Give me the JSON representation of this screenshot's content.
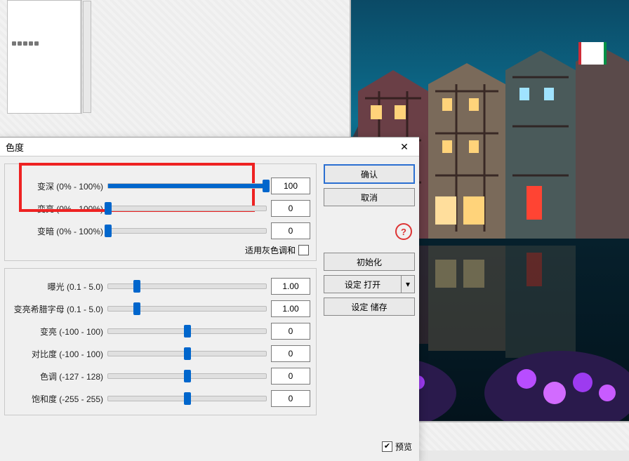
{
  "dialog": {
    "title": "色度",
    "close_icon": "✕",
    "group1": {
      "rows": [
        {
          "label": "变深 (0% - 100%)",
          "value": "100",
          "thumb_pct": 100
        },
        {
          "label": "变亮 (0% - 100%)",
          "value": "0",
          "thumb_pct": 0
        },
        {
          "label": "变暗 (0% - 100%)",
          "value": "0",
          "thumb_pct": 0
        }
      ],
      "gray_option": "适用灰色调和",
      "gray_checked": false
    },
    "group2": {
      "rows": [
        {
          "label": "曝光 (0.1 - 5.0)",
          "value": "1.00",
          "thumb_pct": 18
        },
        {
          "label": "变亮希腊字母 (0.1 - 5.0)",
          "value": "1.00",
          "thumb_pct": 18
        },
        {
          "label": "变亮 (-100 - 100)",
          "value": "0",
          "thumb_pct": 50
        },
        {
          "label": "对比度 (-100 - 100)",
          "value": "0",
          "thumb_pct": 50
        },
        {
          "label": "色调 (-127 - 128)",
          "value": "0",
          "thumb_pct": 50
        },
        {
          "label": "饱和度 (-255 - 255)",
          "value": "0",
          "thumb_pct": 50
        }
      ]
    },
    "buttons": {
      "ok": "确认",
      "cancel": "取消",
      "help": "?",
      "init": "初始化",
      "load": "设定 打开",
      "drop": "▾",
      "save": "设定 储存",
      "preview": "预览",
      "preview_checked": true,
      "preview_mark": "✔"
    }
  }
}
